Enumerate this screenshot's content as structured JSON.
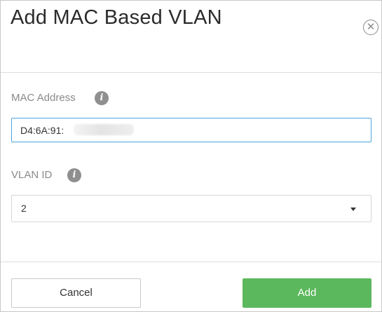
{
  "dialog": {
    "title": "Add MAC Based VLAN",
    "close_icon": "close-circle-icon"
  },
  "mac_address": {
    "label": "MAC Address",
    "info_icon": "info-icon",
    "info_glyph": "i",
    "value": "D4:6A:91:",
    "partially_redacted": true
  },
  "vlan_id": {
    "label": "VLAN ID",
    "info_icon": "info-icon",
    "info_glyph": "i",
    "selected": "2"
  },
  "buttons": {
    "cancel_label": "Cancel",
    "add_label": "Add"
  },
  "colors": {
    "add_button": "#5cb85c",
    "input_focus_border": "#4aa3df",
    "label": "#8a8a8a"
  }
}
